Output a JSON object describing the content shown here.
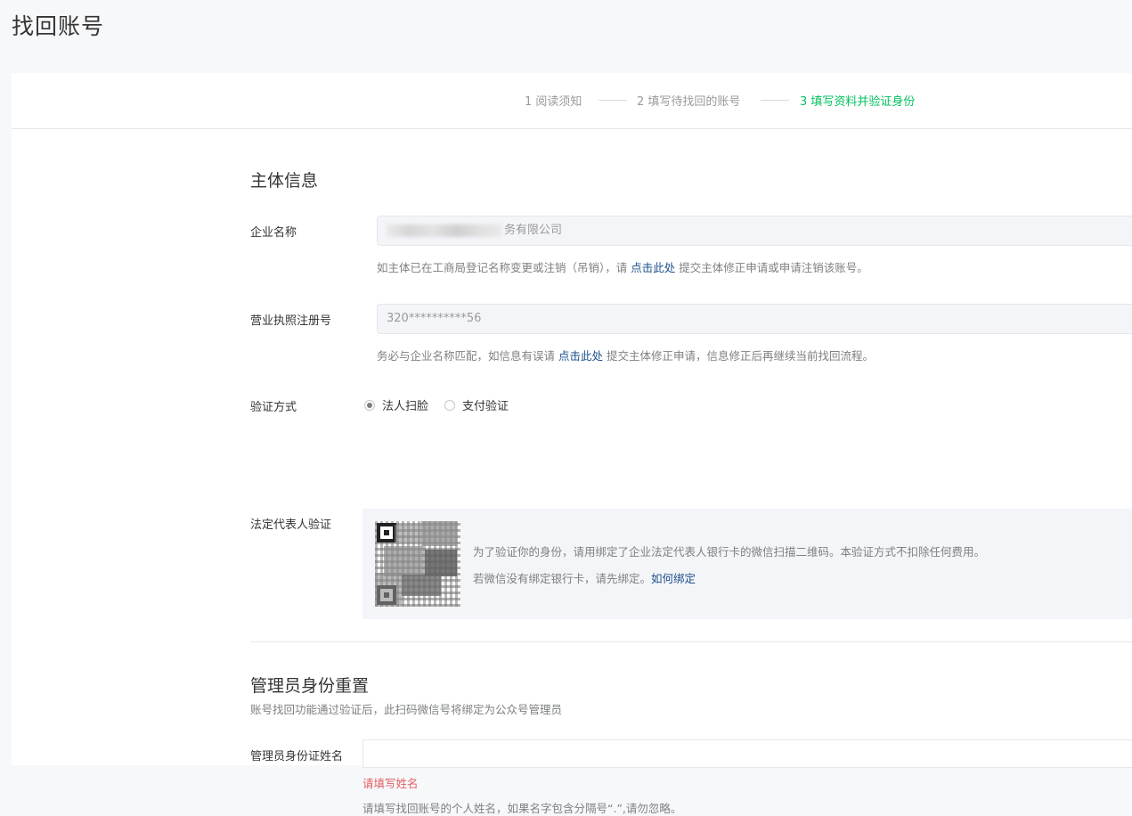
{
  "page": {
    "title": "找回账号"
  },
  "steps": [
    {
      "label": "1 阅读须知",
      "active": false
    },
    {
      "label": "2 填写待找回的账号",
      "active": false
    },
    {
      "label": "3 填写资料并验证身份",
      "active": true
    }
  ],
  "entity": {
    "section_title": "主体信息",
    "company": {
      "label": "企业名称",
      "value_visible_suffix": "务有限公司",
      "hint_before": "如主体已在工商局登记名称变更或注销（吊销），请 ",
      "hint_link": "点击此处",
      "hint_after": " 提交主体修正申请或申请注销该账号。"
    },
    "license": {
      "label": "营业执照注册号",
      "value": "320**********56",
      "hint_before": "务必与企业名称匹配，如信息有误请 ",
      "hint_link": "点击此处",
      "hint_after": " 提交主体修正申请，信息修正后再继续当前找回流程。"
    },
    "verify_method": {
      "label": "验证方式",
      "options": [
        {
          "label": "法人扫脸",
          "checked": true
        },
        {
          "label": "支付验证",
          "checked": false
        }
      ]
    },
    "legal_rep": {
      "label": "法定代表人验证",
      "line1": "为了验证你的身份，请用绑定了企业法定代表人银行卡的微信扫描二维码。本验证方式不扣除任何费用。",
      "line2_before": "若微信没有绑定银行卡，请先绑定。",
      "line2_link": "如何绑定"
    }
  },
  "admin": {
    "section_title": "管理员身份重置",
    "description": "账号找回功能通过验证后，此扫码微信号将绑定为公众号管理员",
    "name_field": {
      "label": "管理员身份证姓名",
      "value": "",
      "error": "请填写姓名",
      "hint": "请填写找回账号的个人姓名，如果名字包含分隔号“.”,请勿忽略。"
    }
  },
  "colors": {
    "accent_green": "#07c160",
    "link_blue": "#1a4e8a",
    "error_red": "#e15f63"
  }
}
